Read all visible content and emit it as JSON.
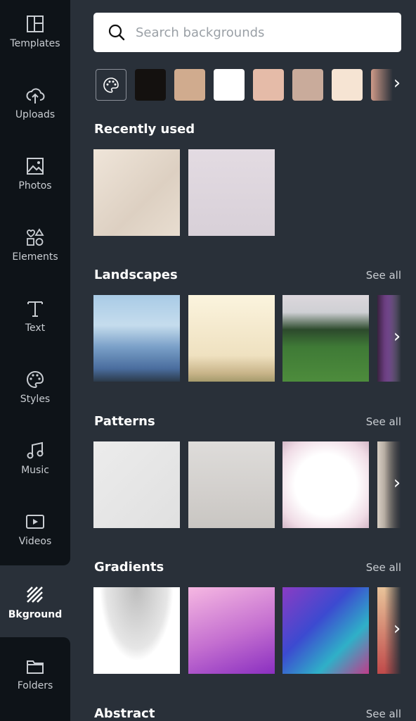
{
  "sidebar": {
    "items": [
      {
        "label": "Templates",
        "icon": "templates-icon"
      },
      {
        "label": "Uploads",
        "icon": "upload-cloud-icon"
      },
      {
        "label": "Photos",
        "icon": "image-icon"
      },
      {
        "label": "Elements",
        "icon": "shapes-icon"
      },
      {
        "label": "Text",
        "icon": "text-icon"
      },
      {
        "label": "Styles",
        "icon": "palette-icon"
      },
      {
        "label": "Music",
        "icon": "music-note-icon"
      },
      {
        "label": "Videos",
        "icon": "video-icon"
      },
      {
        "label": "Bkground",
        "icon": "background-stripes-icon",
        "active": true
      },
      {
        "label": "Folders",
        "icon": "folder-icon"
      }
    ]
  },
  "search": {
    "placeholder": "Search backgrounds"
  },
  "swatches": [
    "#14110f",
    "#d0ab8e",
    "#ffffff",
    "#e5bba8",
    "#c9ab9b",
    "#f6e4d3",
    "#cf9a88"
  ],
  "sections": [
    {
      "title": "Recently used",
      "see_all": ""
    },
    {
      "title": "Landscapes",
      "see_all": "See all"
    },
    {
      "title": "Patterns",
      "see_all": "See all"
    },
    {
      "title": "Gradients",
      "see_all": "See all"
    },
    {
      "title": "Abstract",
      "see_all": "See all"
    }
  ]
}
